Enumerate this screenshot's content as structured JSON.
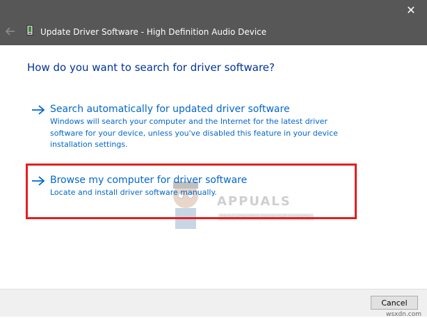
{
  "window": {
    "title": "Update Driver Software - High Definition Audio Device",
    "close_glyph": "✕"
  },
  "main": {
    "question": "How do you want to search for driver software?",
    "options": [
      {
        "title": "Search automatically for updated driver software",
        "description": "Windows will search your computer and the Internet for the latest driver software for your device, unless you've disabled this feature in your device installation settings.",
        "highlighted": false
      },
      {
        "title": "Browse my computer for driver software",
        "description": "Locate and install driver software manually.",
        "highlighted": true
      }
    ]
  },
  "footer": {
    "cancel_label": "Cancel"
  },
  "watermark": {
    "brand": "APPUALS",
    "tagline": "TECH HOW-TO'S FROM THE EXPERTS!",
    "site": "wsxdn.com"
  },
  "colors": {
    "titlebar": "#575757",
    "link": "#0066cc",
    "heading": "#003399",
    "highlight": "#e41e1e"
  }
}
